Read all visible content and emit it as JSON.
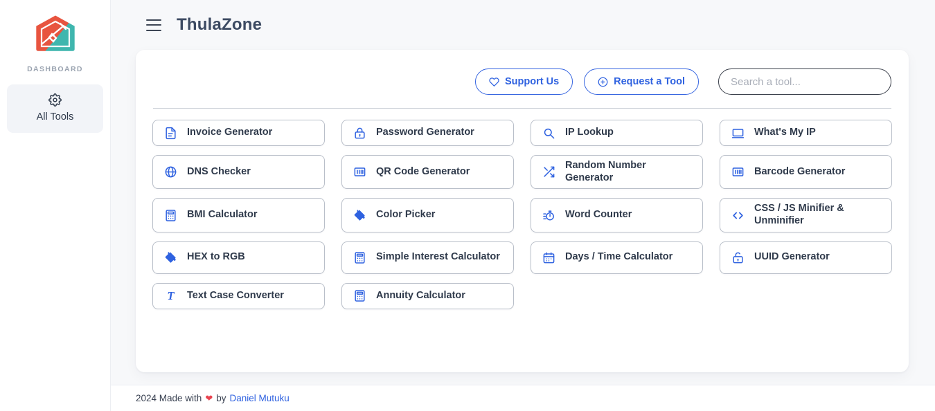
{
  "sidebar": {
    "logo_name": "thulazone-house-tool-logo",
    "logo_colors": {
      "teal": "#3fb6ae",
      "orange": "#e8543f"
    },
    "section_label": "DASHBOARD",
    "items": [
      {
        "label": "All Tools",
        "icon": "gear-icon",
        "active": true
      }
    ]
  },
  "header": {
    "menu_icon": "hamburger-menu-icon",
    "title": "ThulaZone"
  },
  "toolbar": {
    "support_label": "Support Us",
    "support_icon": "heart-icon",
    "request_label": "Request a Tool",
    "request_icon": "plus-circle-icon",
    "search_placeholder": "Search a tool...",
    "search_value": "",
    "accent_color": "#2f62e0"
  },
  "tools": [
    {
      "label": "Invoice Generator",
      "icon": "document-icon"
    },
    {
      "label": "Password Generator",
      "icon": "lock-icon"
    },
    {
      "label": "IP Lookup",
      "icon": "search-icon"
    },
    {
      "label": "What's My IP",
      "icon": "monitor-icon"
    },
    {
      "label": "DNS Checker",
      "icon": "globe-icon"
    },
    {
      "label": "QR Code Generator",
      "icon": "barcode-icon"
    },
    {
      "label": "Random Number Generator",
      "icon": "shuffle-icon"
    },
    {
      "label": "Barcode Generator",
      "icon": "barcode-icon"
    },
    {
      "label": "BMI Calculator",
      "icon": "calculator-icon"
    },
    {
      "label": "Color Picker",
      "icon": "paint-bucket-icon"
    },
    {
      "label": "Word Counter",
      "icon": "stopwatch-icon"
    },
    {
      "label": "CSS / JS Minifier & Unminifier",
      "icon": "code-brackets-icon"
    },
    {
      "label": "HEX to RGB",
      "icon": "paint-bucket-icon"
    },
    {
      "label": "Simple Interest Calculator",
      "icon": "calculator-icon"
    },
    {
      "label": "Days / Time Calculator",
      "icon": "calendar-icon"
    },
    {
      "label": "UUID Generator",
      "icon": "unlock-icon"
    },
    {
      "label": "Text Case Converter",
      "icon": "text-format-icon"
    },
    {
      "label": "Annuity Calculator",
      "icon": "calculator-icon"
    }
  ],
  "footer": {
    "prefix": "2024 Made with",
    "heart": "❤",
    "middle": "by",
    "author": "Daniel Mutuku",
    "link_color": "#2f62e0"
  }
}
